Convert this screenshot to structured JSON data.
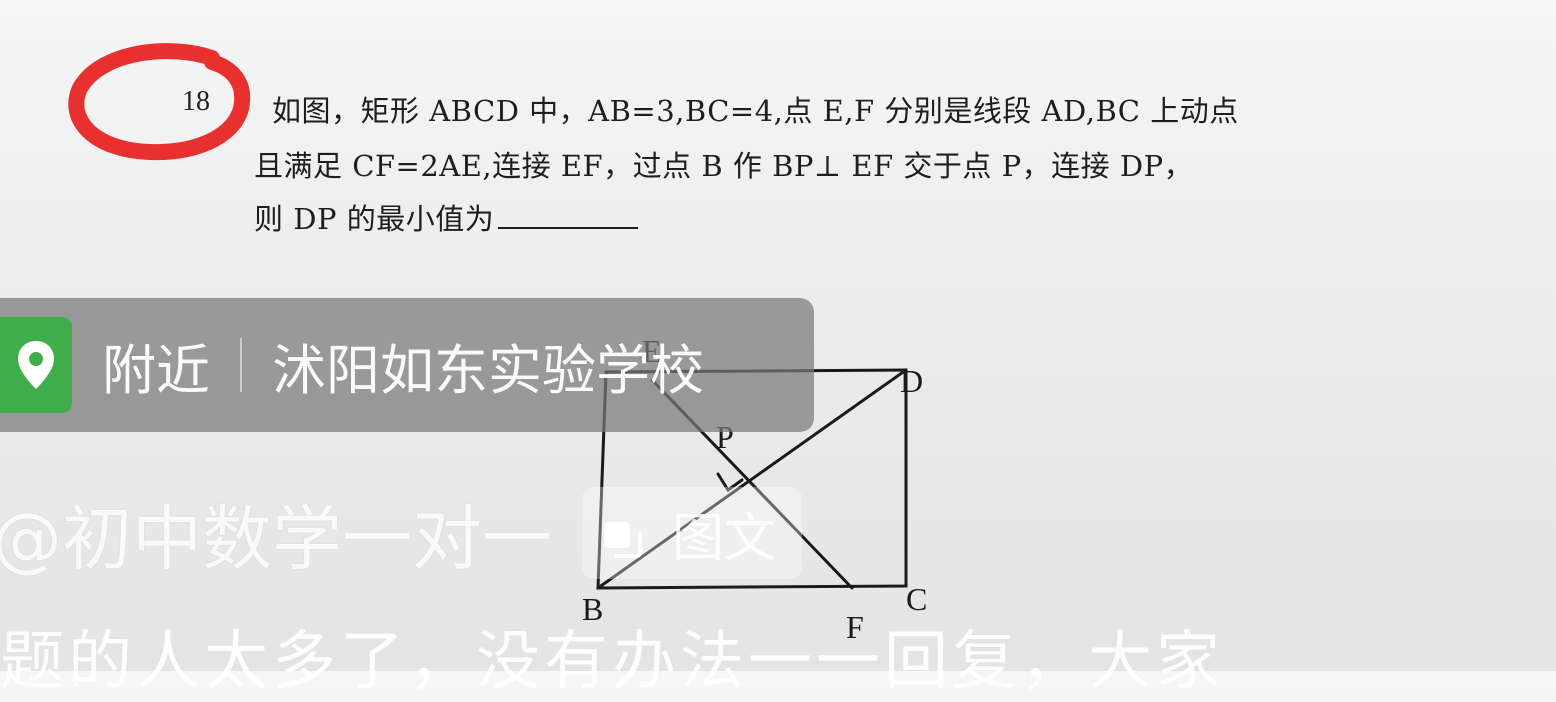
{
  "question": {
    "number": "18",
    "line1": "如图，矩形 ABCD 中，AB=3,BC=4,点 E,F 分别是线段 AD,BC 上动点",
    "line2": "且满足 CF=2AE,连接 EF，过点 B 作 BP⊥ EF 交于点 P，连接 DP，",
    "line3": "则 DP 的最小值为"
  },
  "figure": {
    "labels": {
      "B": "B",
      "C": "C",
      "D": "D",
      "E": "E",
      "F": "F",
      "P": "P"
    }
  },
  "overlay": {
    "location_label": "附近",
    "location_name": "沭阳如东实验学校",
    "author": "@初中数学一对一",
    "tag_label": "图文",
    "caption": "题的人太多了，没有办法一一回复，大家"
  },
  "colors": {
    "pin_green": "#3fae4a",
    "red_marker": "#e8312f"
  },
  "icons": {
    "location": "location-pin-icon",
    "tag": "image-text-icon"
  }
}
